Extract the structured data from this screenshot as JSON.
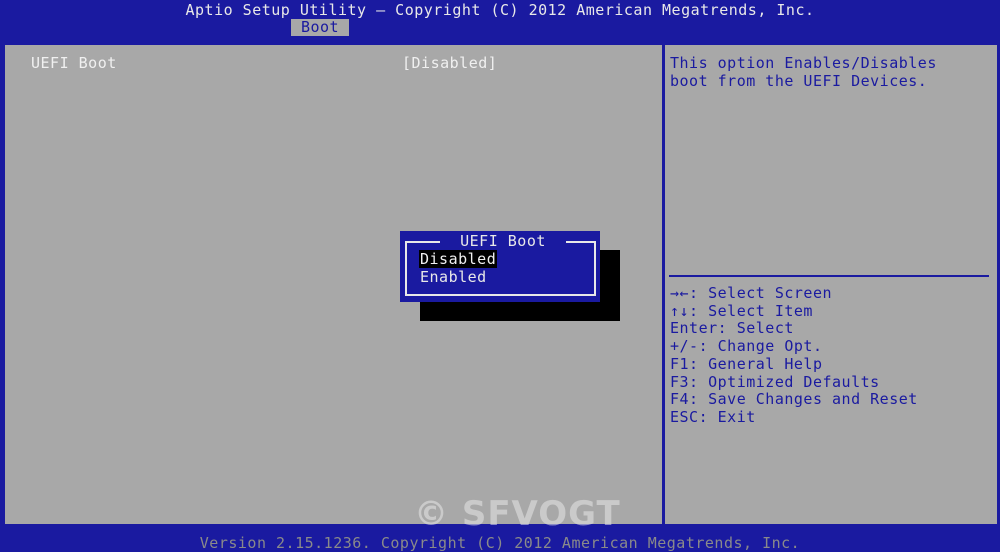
{
  "header": {
    "title": "Aptio Setup Utility – Copyright (C) 2012 American Megatrends, Inc.",
    "active_tab": "Boot"
  },
  "setting": {
    "label": "UEFI Boot",
    "value": "[Disabled]"
  },
  "help": {
    "line1": "This option Enables/Disables",
    "line2": "boot from the UEFI Devices."
  },
  "keys": [
    "→←: Select Screen",
    "↑↓: Select Item",
    "Enter: Select",
    "+/-: Change Opt.",
    "F1: General Help",
    "F3: Optimized Defaults",
    "F4: Save Changes and Reset",
    "ESC: Exit"
  ],
  "popup": {
    "title": "UEFI Boot",
    "options": [
      "Disabled",
      "Enabled"
    ],
    "selected": "Disabled"
  },
  "watermark": "© SFVOGT",
  "footer": "Version 2.15.1236. Copyright (C) 2012 American Megatrends, Inc.",
  "colors": {
    "bios_blue": "#1a1aa0",
    "panel_gray": "#a8a8a8",
    "text_white": "#f0f0f0"
  }
}
